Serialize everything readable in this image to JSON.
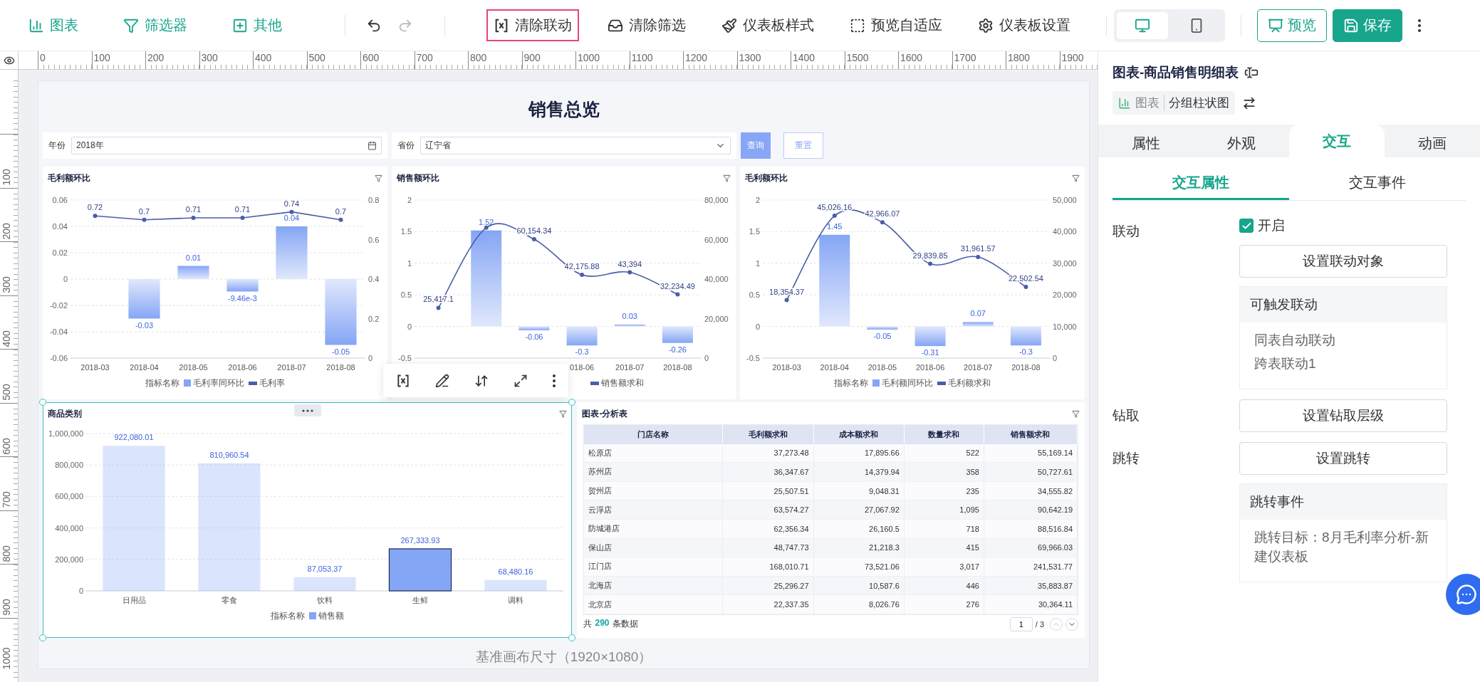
{
  "toolbar": {
    "insert_items": [
      {
        "label": "图表"
      },
      {
        "label": "筛选器"
      },
      {
        "label": "其他"
      }
    ],
    "actions": [
      {
        "label": "清除联动",
        "highlighted": true
      },
      {
        "label": "清除筛选",
        "highlighted": false
      },
      {
        "label": "仪表板样式",
        "highlighted": false
      },
      {
        "label": "预览自适应",
        "highlighted": false
      },
      {
        "label": "仪表板设置",
        "highlighted": false
      }
    ],
    "devices": [
      {
        "selected": true
      },
      {
        "selected": false
      }
    ],
    "preview_button": "预览",
    "save_button": "保存"
  },
  "ruler": {
    "top_labels": [
      "0",
      "100",
      "200",
      "300",
      "400",
      "500",
      "600",
      "700",
      "800",
      "900",
      "1000",
      "1100",
      "1200",
      "1300",
      "1400",
      "1500",
      "1600",
      "1700",
      "1800",
      "1900"
    ],
    "left_labels": [
      "100",
      "200",
      "300",
      "400",
      "500",
      "600",
      "700",
      "800",
      "900",
      "1000"
    ]
  },
  "dashboard": {
    "title": "销售总览",
    "filters": [
      {
        "kind": "date",
        "label": "年份",
        "value": "2018年"
      },
      {
        "kind": "select",
        "label": "省份",
        "value": "辽宁省"
      }
    ],
    "query_button": "查询",
    "reset_button": "重置",
    "charts": [
      {
        "title": "毛利额环比",
        "legend_title": "指标名称",
        "bars": {
          "chart_data": {
            "type": "bar",
            "categories": [
              "2018-03",
              "2018-04",
              "2018-05",
              "2018-06",
              "2018-07",
              "2018-08"
            ],
            "grid": true,
            "legend": "bottom",
            "series": [
              {
                "name": "毛利率同环比",
                "color": "#85a5f5",
                "values": [
                  null,
                  -0.03,
                  0.01,
                  -0.00946,
                  0.04,
                  -0.05
                ],
                "value_labels": [
                  null,
                  "-0.03",
                  "0.01",
                  "-9.46e-3",
                  "0.04",
                  "-0.05"
                ]
              }
            ],
            "ylim": [
              -0.06,
              0.06
            ],
            "yticks": [
              -0.06,
              -0.04,
              -0.02,
              0,
              0.02,
              0.04,
              0.06
            ]
          }
        },
        "line": {
          "smooth": false,
          "chart_data": {
            "type": "line",
            "series": [
              {
                "name": "毛利率",
                "color": "#4a5da8",
                "marker": "circle",
                "values": [
                  0.72,
                  0.7,
                  0.71,
                  0.71,
                  0.74,
                  0.7
                ],
                "value_labels": [
                  "0.72",
                  "0.7",
                  "0.71",
                  "0.71",
                  "0.74",
                  "0.7"
                ]
              }
            ],
            "ylim": [
              0,
              0.8
            ],
            "yticks": [
              0,
              0.2,
              0.4,
              0.6,
              0.8
            ]
          }
        }
      },
      {
        "title": "销售额环比",
        "bars": {
          "chart_data": {
            "type": "bar",
            "categories": [
              null,
              null,
              null,
              "018-06",
              "2018-07",
              "2018-08"
            ],
            "grid": true,
            "series": [
              {
                "color": "#85a5f5",
                "values": [
                  null,
                  1.52,
                  -0.06,
                  -0.3,
                  0.03,
                  -0.26
                ],
                "value_labels": [
                  null,
                  "1.52",
                  "-0.06",
                  "-0.3",
                  "0.03",
                  "-0.26"
                ]
              }
            ],
            "ylim": [
              -0.5,
              2
            ],
            "yticks": [
              -0.5,
              0,
              0.5,
              1,
              1.5,
              2
            ]
          }
        },
        "line": {
          "smooth": true,
          "chart_data": {
            "type": "line",
            "series": [
              {
                "name": "销售额求和",
                "color": "#4a5da8",
                "marker": "circle",
                "values": [
                  25417.1,
                  66000,
                  60154.34,
                  42175.88,
                  43394,
                  32234.49
                ],
                "value_labels": [
                  "25,417.1",
                  null,
                  "60,154.34",
                  "42,175.88",
                  "43,394",
                  "32,234.49"
                ]
              }
            ],
            "ylim": [
              0,
              80000
            ],
            "yticks": [
              0,
              {
                "value": 20000,
                "label": "20,000"
              },
              {
                "value": 40000,
                "label": "40,000"
              },
              {
                "value": 60000,
                "label": "60,000"
              },
              {
                "value": 80000,
                "label": "80,000"
              }
            ]
          }
        }
      },
      {
        "title": "毛利额环比",
        "legend_title": "指标名称",
        "bars": {
          "chart_data": {
            "type": "bar",
            "categories": [
              "2018-03",
              "2018-04",
              "2018-05",
              "2018-06",
              "2018-07",
              "2018-08"
            ],
            "grid": true,
            "legend": "bottom",
            "series": [
              {
                "name": "毛利额同环比",
                "color": "#85a5f5",
                "values": [
                  null,
                  1.45,
                  -0.05,
                  -0.31,
                  0.07,
                  -0.3
                ],
                "value_labels": [
                  null,
                  "1.45",
                  "-0.05",
                  "-0.31",
                  "0.07",
                  "-0.3"
                ]
              }
            ],
            "ylim": [
              -0.5,
              2
            ],
            "yticks": [
              -0.5,
              0,
              0.5,
              1,
              1.5,
              2
            ]
          }
        },
        "line": {
          "smooth": true,
          "chart_data": {
            "type": "line",
            "series": [
              {
                "name": "毛利额求和",
                "color": "#4a5da8",
                "marker": "circle",
                "values": [
                  18354.37,
                  45026.16,
                  42966.07,
                  29839.85,
                  31961.57,
                  22502.54
                ],
                "value_labels": [
                  "18,354.37",
                  "45,026.16",
                  "42,966.07",
                  "29,839.85",
                  "31,961.57",
                  "22,502.54"
                ]
              }
            ],
            "ylim": [
              0,
              50000
            ],
            "yticks": [
              0,
              {
                "value": 10000,
                "label": "10,000"
              },
              {
                "value": 20000,
                "label": "20,000"
              },
              {
                "value": 30000,
                "label": "30,000"
              },
              {
                "value": 40000,
                "label": "40,000"
              },
              {
                "value": 50000,
                "label": "50,000"
              }
            ]
          }
        }
      }
    ],
    "category_chart": {
      "title": "商品类别",
      "selected": true,
      "legend_title": "指标名称",
      "selected_bars": [
        false,
        false,
        false,
        true,
        false
      ],
      "chart_data": {
        "type": "bar",
        "categories": [
          "日用品",
          "零食",
          "饮料",
          "生鲜",
          "调料"
        ],
        "grid": true,
        "legend": "bottom",
        "series": [
          {
            "name": "销售额",
            "color": "#85a5f5",
            "values": [
              922080.01,
              810960.54,
              87053.37,
              267333.93,
              68480.16
            ],
            "value_labels": [
              "922,080.01",
              "810,960.54",
              "87,053.37",
              "267,333.93",
              "68,480.16"
            ]
          }
        ],
        "ylim": [
          0,
          1000000
        ],
        "yticks": [
          0,
          {
            "value": 200000,
            "label": "200,000"
          },
          {
            "value": 400000,
            "label": "400,000"
          },
          {
            "value": 600000,
            "label": "600,000"
          },
          {
            "value": 800000,
            "label": "800,000"
          },
          {
            "value": 1000000,
            "label": "1,000,000"
          }
        ]
      }
    },
    "table": {
      "title": "图表-分析表",
      "columns": [
        "门店名称",
        "毛利额求和",
        "成本额求和",
        "数量求和",
        "销售额求和"
      ],
      "rows": [
        [
          "松原店",
          "37,273.48",
          "17,895.66",
          "522",
          "55,169.14"
        ],
        [
          "苏州店",
          "36,347.67",
          "14,379.94",
          "358",
          "50,727.61"
        ],
        [
          "贺州店",
          "25,507.51",
          "9,048.31",
          "235",
          "34,555.82"
        ],
        [
          "云浮店",
          "63,574.27",
          "27,067.92",
          "1,095",
          "90,642.19"
        ],
        [
          "防城港店",
          "62,356.34",
          "26,160.5",
          "718",
          "88,516.84"
        ],
        [
          "保山店",
          "48,747.73",
          "21,218.3",
          "415",
          "69,966.03"
        ],
        [
          "江门店",
          "168,010.71",
          "73,521.06",
          "3,017",
          "241,531.77"
        ],
        [
          "北海店",
          "25,296.27",
          "10,587.6",
          "446",
          "35,883.87"
        ],
        [
          "北京店",
          "22,337.35",
          "8,026.76",
          "276",
          "30,364.11"
        ]
      ],
      "total_prefix": "共",
      "total_count": "290",
      "total_suffix": "条数据",
      "page": "1",
      "page_total": "/ 3"
    },
    "canvas_caption": "基准画布尺寸（1920×1080）"
  },
  "panel": {
    "title": "图表-商品销售明细表",
    "chip_type": "图表",
    "chip_subtype": "分组柱状图",
    "tabs": [
      {
        "label": "属性",
        "selected": false
      },
      {
        "label": "外观",
        "selected": false
      },
      {
        "label": "交互",
        "selected": true
      },
      {
        "label": "动画",
        "selected": false
      }
    ],
    "subtabs": [
      {
        "label": "交互属性",
        "selected": true
      },
      {
        "label": "交互事件",
        "selected": false
      }
    ],
    "sections": [
      {
        "label": "联动",
        "checkbox": {
          "label": "开启",
          "checked": true
        },
        "button": "设置联动对象",
        "box": {
          "title": "可触发联动",
          "lines": [
            "同表自动联动",
            "跨表联动1"
          ]
        }
      },
      {
        "label": "钻取",
        "button": "设置钻取层级"
      },
      {
        "label": "跳转",
        "button": "设置跳转",
        "box": {
          "title": "跳转事件",
          "lines": [
            "跳转目标：8月毛利率分析-新建仪表板"
          ]
        }
      }
    ]
  }
}
